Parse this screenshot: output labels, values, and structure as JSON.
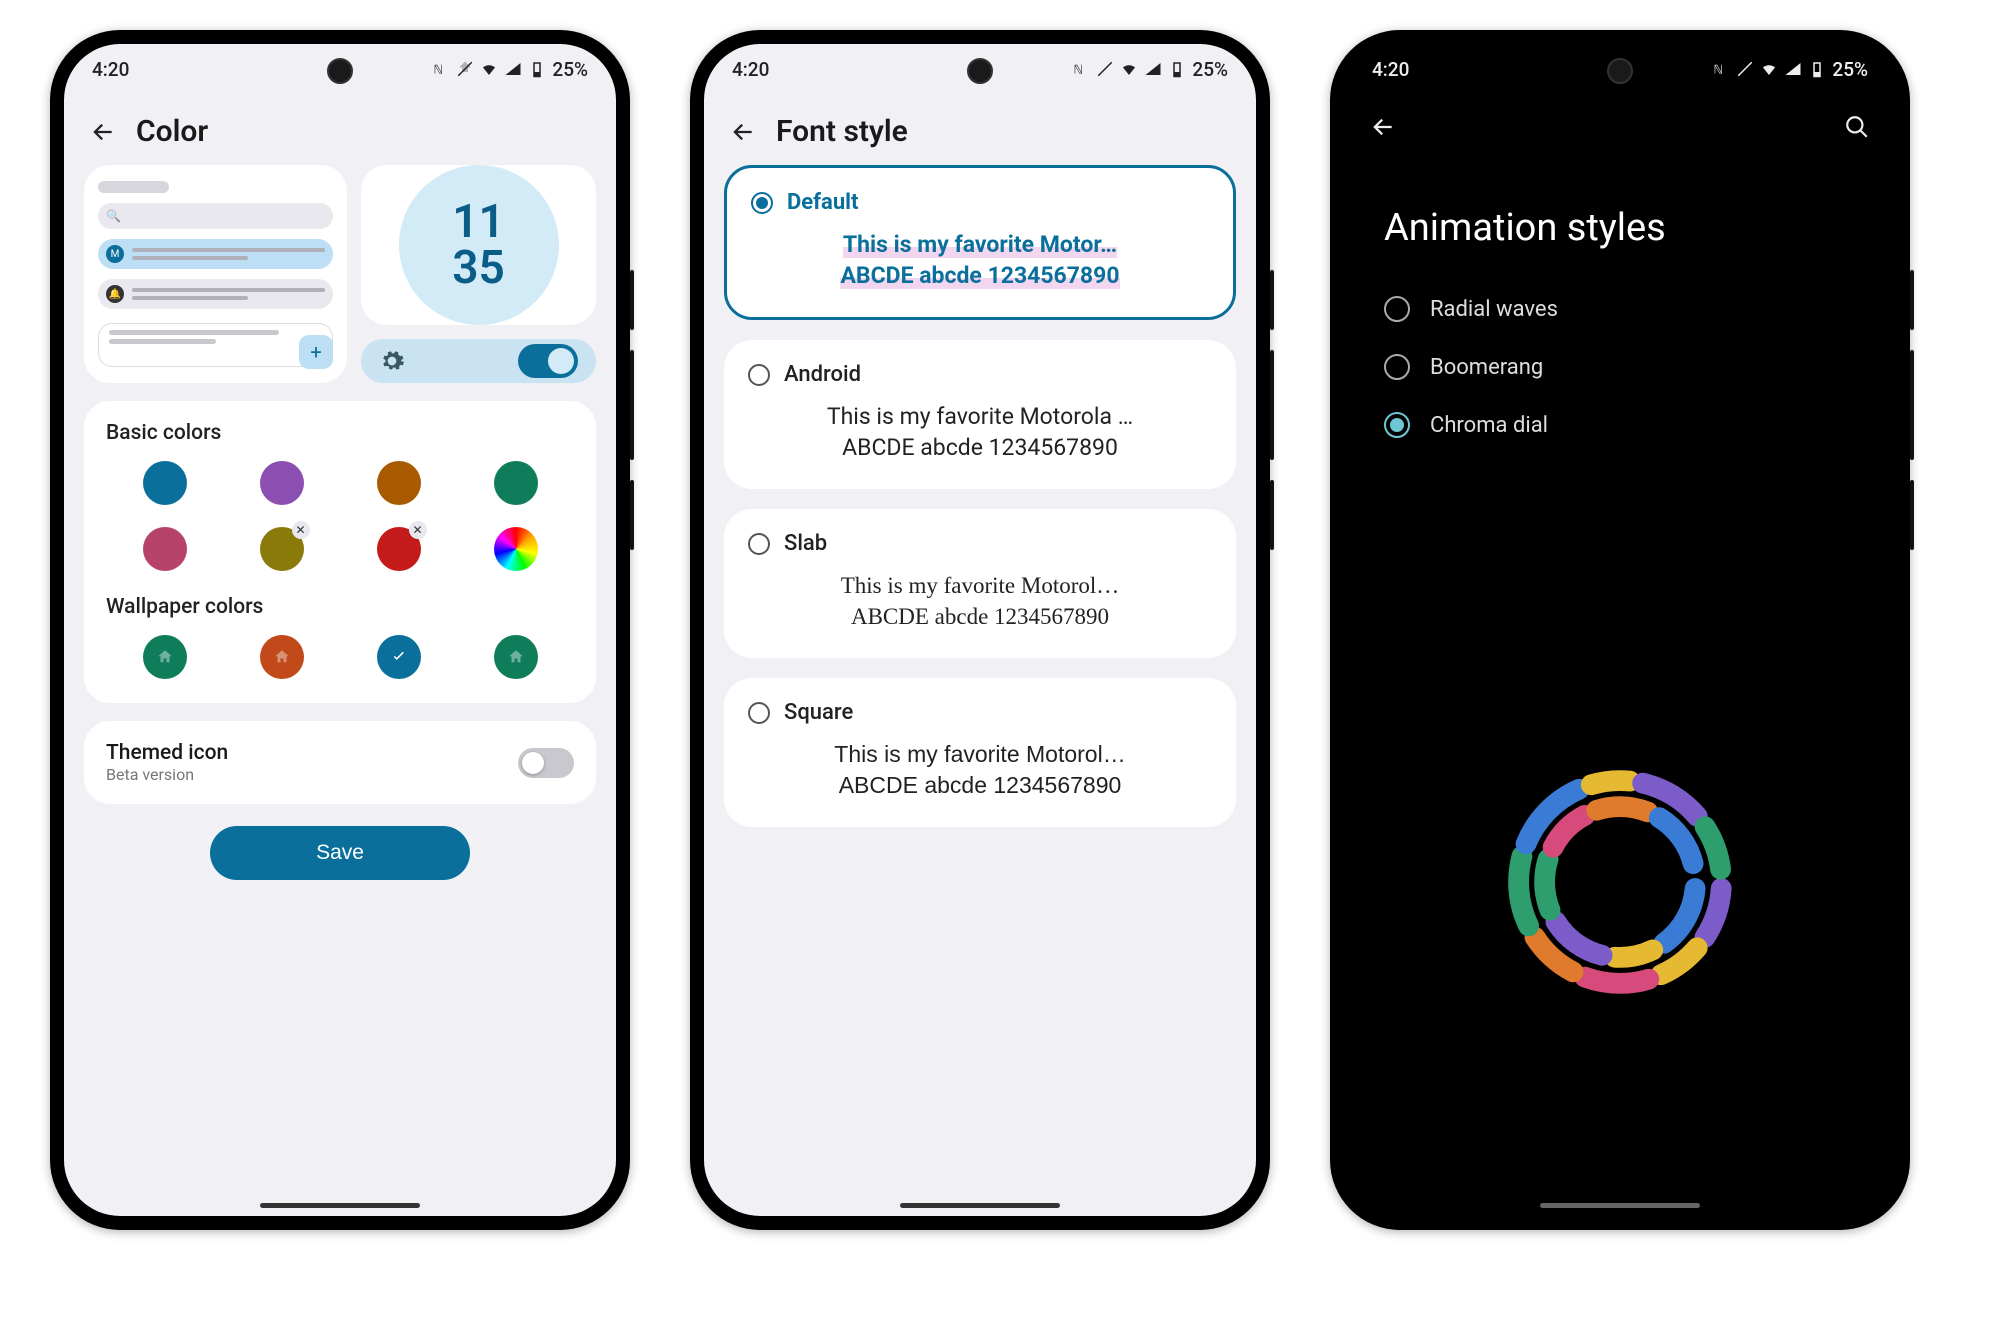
{
  "statusbar": {
    "time": "4:20",
    "battery": "25%"
  },
  "phone1": {
    "title": "Color",
    "clock": {
      "line1": "11",
      "line2": "35"
    },
    "basic_heading": "Basic colors",
    "basic_colors": [
      {
        "hex": "#0a6f9b",
        "removable": false
      },
      {
        "hex": "#8a4fb0",
        "removable": false
      },
      {
        "hex": "#a75a00",
        "removable": false
      },
      {
        "hex": "#0f7d5a",
        "removable": false
      },
      {
        "hex": "#b8436a",
        "removable": false
      },
      {
        "hex": "#8a7a0a",
        "removable": true
      },
      {
        "hex": "#c51a1a",
        "removable": true
      },
      {
        "hex": "rainbow",
        "removable": false
      }
    ],
    "wallpaper_heading": "Wallpaper colors",
    "wallpaper_colors": [
      {
        "hex": "#0f7d5a",
        "selected": false
      },
      {
        "hex": "#c24a1a",
        "selected": false
      },
      {
        "hex": "#0a6f9b",
        "selected": true
      },
      {
        "hex": "#0f7d5a",
        "selected": false
      }
    ],
    "themed": {
      "title": "Themed icon",
      "subtitle": "Beta version",
      "on": false
    },
    "save_label": "Save",
    "plus_label": "+"
  },
  "phone2": {
    "title": "Font style",
    "sample_line1": "This is my favorite Motor…",
    "sample_line1b": "This is my favorite Motorola …",
    "sample_line1c": "This is my favorite Motorol…",
    "sample_line1d": "This is my favorite Motorol…",
    "sample_line2": "ABCDE abcde 1234567890",
    "fonts": [
      {
        "name": "Default",
        "selected": true
      },
      {
        "name": "Android",
        "selected": false
      },
      {
        "name": "Slab",
        "selected": false
      },
      {
        "name": "Square",
        "selected": false
      }
    ]
  },
  "phone3": {
    "title": "Animation styles",
    "options": [
      {
        "name": "Radial waves",
        "selected": false
      },
      {
        "name": "Boomerang",
        "selected": false
      },
      {
        "name": "Chroma dial",
        "selected": true
      }
    ]
  }
}
